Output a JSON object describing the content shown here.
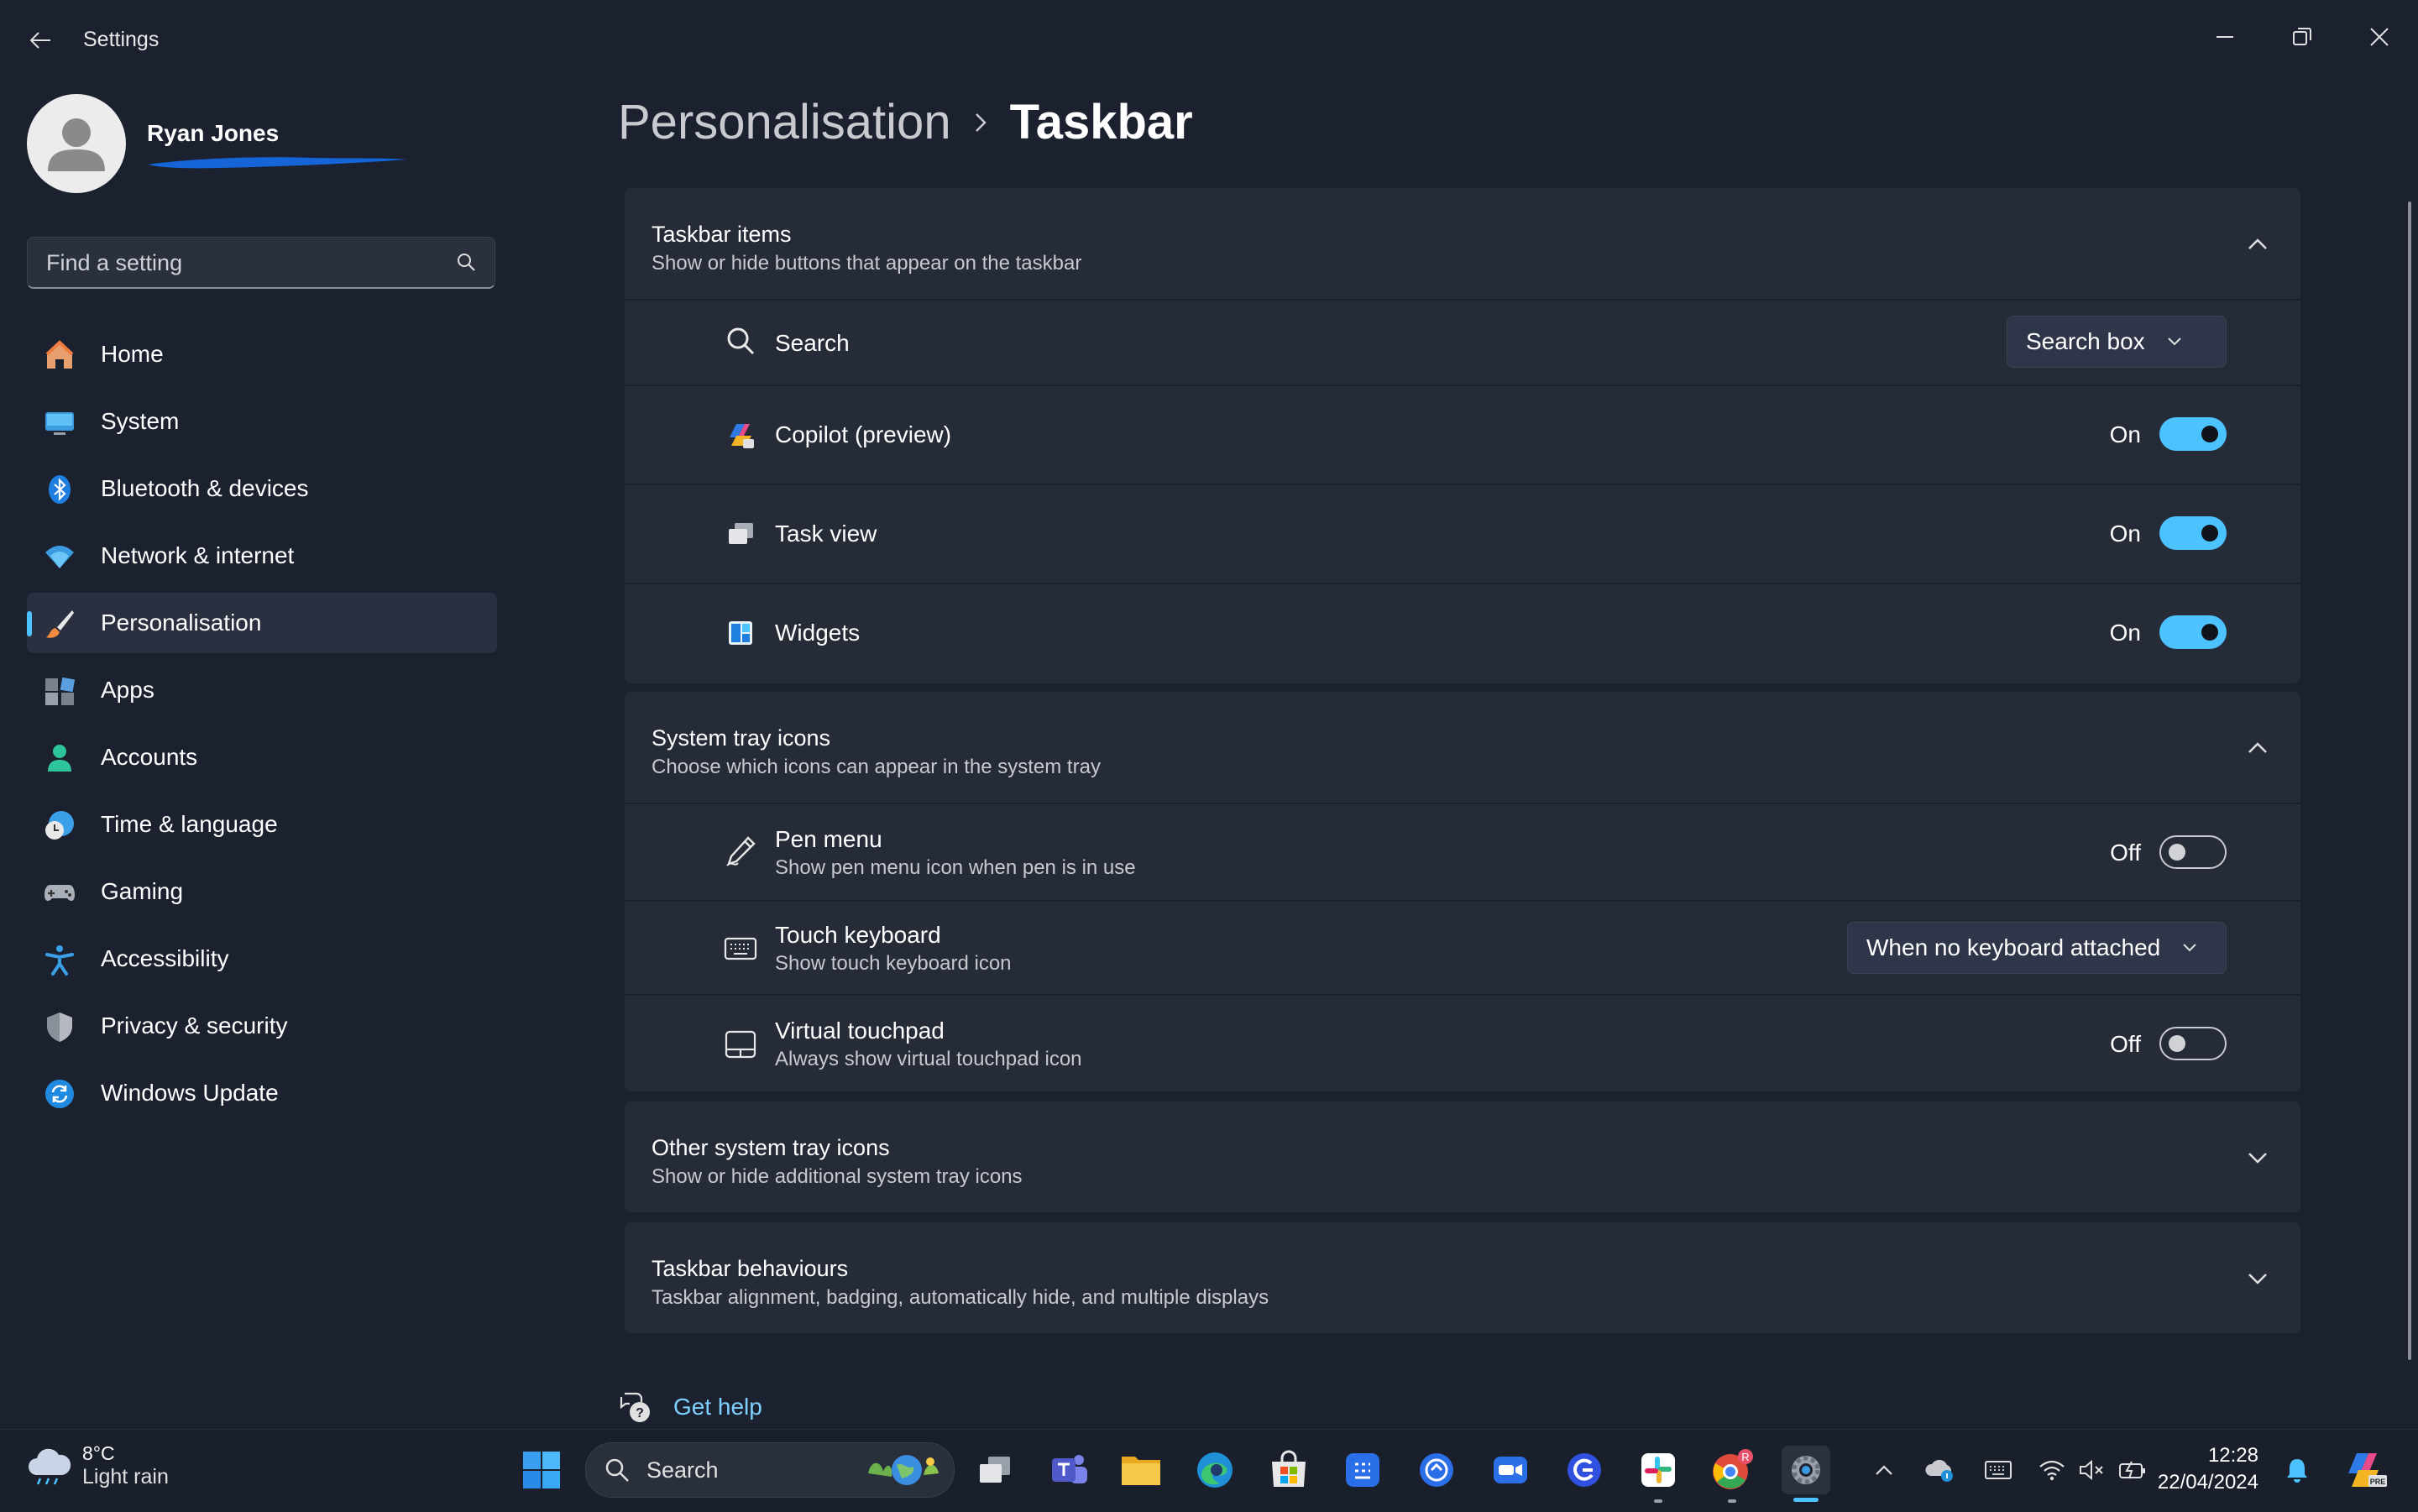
{
  "window": {
    "title": "Settings"
  },
  "profile": {
    "name": "Ryan Jones"
  },
  "search": {
    "placeholder": "Find a setting"
  },
  "nav": {
    "items": [
      {
        "label": "Home",
        "icon": "home-icon"
      },
      {
        "label": "System",
        "icon": "monitor-icon"
      },
      {
        "label": "Bluetooth & devices",
        "icon": "bluetooth-icon"
      },
      {
        "label": "Network & internet",
        "icon": "wifi-icon"
      },
      {
        "label": "Personalisation",
        "icon": "brush-icon",
        "selected": true
      },
      {
        "label": "Apps",
        "icon": "apps-icon"
      },
      {
        "label": "Accounts",
        "icon": "person-icon"
      },
      {
        "label": "Time & language",
        "icon": "globe-clock-icon"
      },
      {
        "label": "Gaming",
        "icon": "gamepad-icon"
      },
      {
        "label": "Accessibility",
        "icon": "accessibility-icon"
      },
      {
        "label": "Privacy & security",
        "icon": "shield-icon"
      },
      {
        "label": "Windows Update",
        "icon": "update-icon"
      }
    ]
  },
  "breadcrumb": {
    "parent": "Personalisation",
    "current": "Taskbar"
  },
  "sections": {
    "taskbar_items": {
      "title": "Taskbar items",
      "subtitle": "Show or hide buttons that appear on the taskbar",
      "expanded": true,
      "search": {
        "label": "Search",
        "value": "Search box"
      },
      "copilot": {
        "label": "Copilot (preview)",
        "state": "On",
        "on": true
      },
      "task_view": {
        "label": "Task view",
        "state": "On",
        "on": true
      },
      "widgets": {
        "label": "Widgets",
        "state": "On",
        "on": true
      }
    },
    "system_tray": {
      "title": "System tray icons",
      "subtitle": "Choose which icons can appear in the system tray",
      "expanded": true,
      "pen_menu": {
        "label": "Pen menu",
        "desc": "Show pen menu icon when pen is in use",
        "state": "Off",
        "on": false
      },
      "touch_keyboard": {
        "label": "Touch keyboard",
        "desc": "Show touch keyboard icon",
        "value": "When no keyboard attached"
      },
      "virtual_touchpad": {
        "label": "Virtual touchpad",
        "desc": "Always show virtual touchpad icon",
        "state": "Off",
        "on": false
      }
    },
    "other_tray": {
      "title": "Other system tray icons",
      "subtitle": "Show or hide additional system tray icons",
      "expanded": false
    },
    "behaviours": {
      "title": "Taskbar behaviours",
      "subtitle": "Taskbar alignment, badging, automatically hide, and multiple displays",
      "expanded": false
    }
  },
  "help": {
    "label": "Get help"
  },
  "taskbar": {
    "weather": {
      "temp": "8°C",
      "condition": "Light rain"
    },
    "search_label": "Search",
    "clock": {
      "time": "12:28",
      "date": "22/04/2024"
    },
    "accent": "#4cc2ff"
  }
}
